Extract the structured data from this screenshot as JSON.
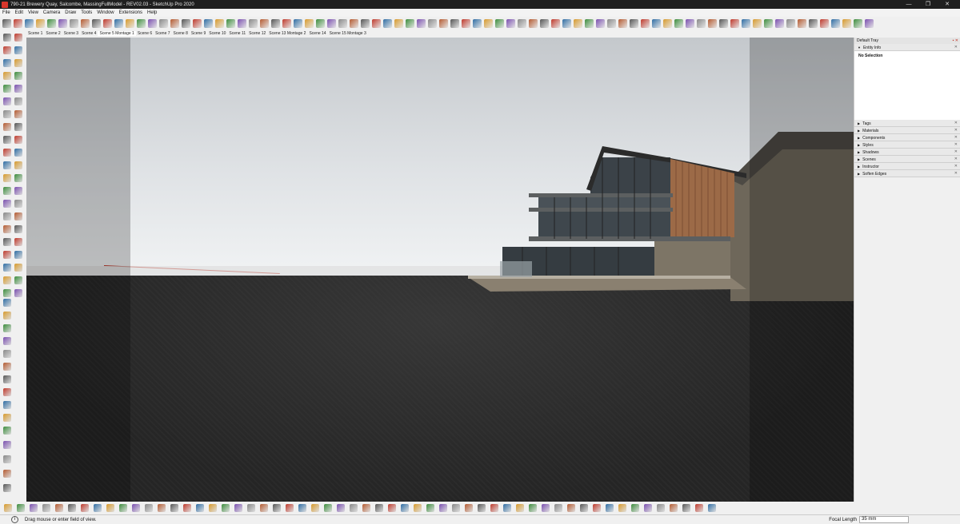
{
  "window": {
    "title": "790-21 Brewery Quay, Salcombe, MassingFullModel - REV02.03 - SketchUp Pro 2020",
    "controls": [
      "—",
      "❐",
      "✕"
    ]
  },
  "menu": [
    "File",
    "Edit",
    "View",
    "Camera",
    "Draw",
    "Tools",
    "Window",
    "Extensions",
    "Help"
  ],
  "scenes": [
    {
      "label": "Scene 1"
    },
    {
      "label": "Scene 2"
    },
    {
      "label": "Scene 3"
    },
    {
      "label": "Scene 4"
    },
    {
      "label": "Scene 5 Montage 1",
      "active": true
    },
    {
      "label": "Scene 6"
    },
    {
      "label": "Scene 7"
    },
    {
      "label": "Scene 8"
    },
    {
      "label": "Scene 9"
    },
    {
      "label": "Scene 10"
    },
    {
      "label": "Scene 11"
    },
    {
      "label": "Scene 12"
    },
    {
      "label": "Scene 13 Montage 2"
    },
    {
      "label": "Scene 14"
    },
    {
      "label": "Scene 15 Montage 3"
    }
  ],
  "tray": {
    "title": "Default Tray",
    "entity_info": {
      "label": "Entity Info",
      "selection": "No Selection"
    },
    "panels": [
      "Tags",
      "Materials",
      "Components",
      "Styles",
      "Shadows",
      "Scenes",
      "Instructor",
      "Soften Edges"
    ]
  },
  "status": {
    "message": "Drag mouse or enter field of view.",
    "vcb_label": "Focal Length",
    "vcb_value": "35 mm"
  },
  "colors": {
    "titlebar": "#1f1f1f",
    "chrome": "#f0f0f0",
    "sky_top": "#c4c8cc",
    "ground": "#262626",
    "timber": "#9c6a47",
    "stone": "#7d7566",
    "axis_red": "#c0392b"
  }
}
